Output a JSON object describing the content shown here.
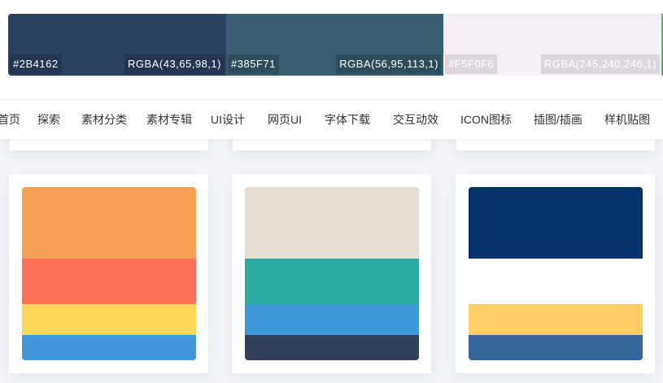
{
  "strip": {
    "swatches": [
      {
        "hex": "#2B4162",
        "rgba": "RGBA(43,65,98,1)",
        "color": "#2b4162"
      },
      {
        "hex": "#385F71",
        "rgba": "RGBA(56,95,113,1)",
        "color": "#385f71"
      },
      {
        "hex": "#F5F0F6",
        "rgba": "RGBA(245,240,246,1)",
        "color": "#f5f0f6"
      }
    ]
  },
  "nav": {
    "items": [
      {
        "label": "首页"
      },
      {
        "label": "探索"
      },
      {
        "label": "素材分类"
      },
      {
        "label": "素材专辑"
      },
      {
        "label": "UI设计"
      },
      {
        "label": "网页UI"
      },
      {
        "label": "字体下载"
      },
      {
        "label": "交互动效"
      },
      {
        "label": "ICON图标"
      },
      {
        "label": "插图/插画"
      },
      {
        "label": "样机贴图"
      }
    ]
  },
  "top_cards": [
    {
      "accent": "#7aa98f"
    },
    {
      "accent": "#efd48a"
    },
    {
      "accent": "#e08a8a"
    }
  ],
  "palettes": [
    {
      "colors": [
        "#F6A057",
        "#FD7058",
        "#FED85A",
        "#4396D9"
      ]
    },
    {
      "colors": [
        "#E5DFD5",
        "#2BABA1",
        "#3D97D8",
        "#34405A"
      ]
    },
    {
      "colors": [
        "#043369",
        "#FFFFFF",
        "#FFCC66",
        "#336699"
      ]
    }
  ]
}
